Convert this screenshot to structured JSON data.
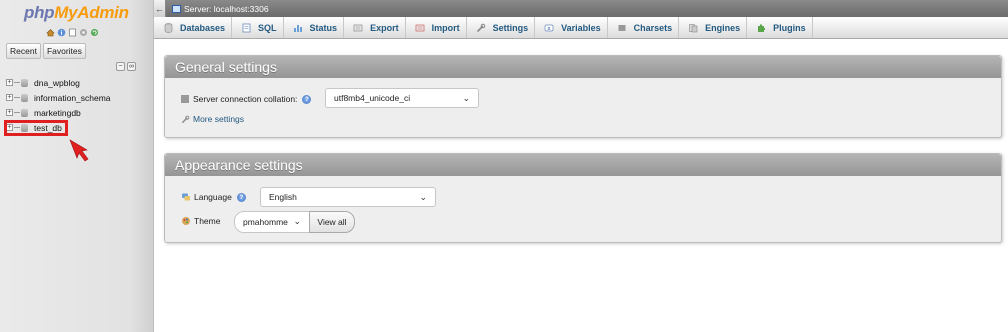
{
  "logo": {
    "php": "php",
    "myadmin": "MyAdmin"
  },
  "nav": {
    "quick_icons": [
      "home-icon",
      "info-icon",
      "docs-icon",
      "settings-icon",
      "reload-icon"
    ],
    "tabs": {
      "recent": "Recent",
      "favorites": "Favorites"
    },
    "databases": [
      "dna_wpblog",
      "information_schema",
      "marketingdb",
      "test_db"
    ]
  },
  "topbar": {
    "server": "Server: localhost:3306"
  },
  "menu": [
    {
      "label": "Databases",
      "icon": "database-icon"
    },
    {
      "label": "SQL",
      "icon": "sql-icon"
    },
    {
      "label": "Status",
      "icon": "status-icon"
    },
    {
      "label": "Export",
      "icon": "export-icon"
    },
    {
      "label": "Import",
      "icon": "import-icon"
    },
    {
      "label": "Settings",
      "icon": "wrench-icon"
    },
    {
      "label": "Variables",
      "icon": "variables-icon"
    },
    {
      "label": "Charsets",
      "icon": "charsets-icon"
    },
    {
      "label": "Engines",
      "icon": "engines-icon"
    },
    {
      "label": "Plugins",
      "icon": "plugins-icon"
    }
  ],
  "general": {
    "title": "General settings",
    "collation_label": "Server connection collation:",
    "collation_value": "utf8mb4_unicode_ci",
    "more_settings": "More settings"
  },
  "appearance": {
    "title": "Appearance settings",
    "language_label": "Language",
    "language_value": "English",
    "theme_label": "Theme",
    "theme_value": "pmahomme",
    "view_all": "View all"
  },
  "colors": {
    "accent": "#235a81",
    "highlight": "#e02020",
    "logo_php": "#6c78af",
    "logo_myadmin": "#f89c0e"
  }
}
